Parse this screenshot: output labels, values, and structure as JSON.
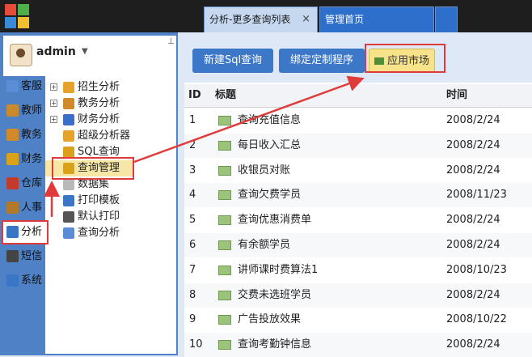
{
  "tabs": [
    {
      "label": "分析-更多查询列表",
      "close": "×"
    },
    {
      "label": "管理首页"
    }
  ],
  "user": {
    "name": "admin",
    "caret": "▼",
    "pin": "ᵖ"
  },
  "nav": [
    {
      "label": "客服",
      "icon": "headset-icon",
      "color": "#5b8dd6"
    },
    {
      "label": "教师",
      "icon": "teacher-book-icon",
      "color": "#c98a2b"
    },
    {
      "label": "教务",
      "icon": "academic-icon",
      "color": "#d08a2a"
    },
    {
      "label": "财务",
      "icon": "finance-icon",
      "color": "#d9a21a"
    },
    {
      "label": "仓库",
      "icon": "warehouse-icon",
      "color": "#c23b2b"
    },
    {
      "label": "人事",
      "icon": "personnel-icon",
      "color": "#b07a2a"
    },
    {
      "label": "分析",
      "icon": "bar-chart-icon",
      "color": "#3a76c6",
      "active": true
    },
    {
      "label": "短信",
      "icon": "phone-icon",
      "color": "#444444"
    },
    {
      "label": "系统",
      "icon": "system-icon",
      "color": "#3a76c6"
    }
  ],
  "tree": [
    {
      "label": "招生分析",
      "expandable": true,
      "icon": "search-icon",
      "color": "#e6a32a"
    },
    {
      "label": "教务分析",
      "expandable": true,
      "icon": "academic-icon",
      "color": "#d08a2a"
    },
    {
      "label": "财务分析",
      "expandable": true,
      "icon": "finance-icon",
      "color": "#3a6fc7"
    },
    {
      "label": "超级分析器",
      "expandable": false,
      "icon": "magnifier-icon",
      "color": "#e6a32a"
    },
    {
      "label": "SQL查询",
      "expandable": false,
      "icon": "sql-icon",
      "color": "#d9a21a"
    },
    {
      "label": "查询管理",
      "expandable": false,
      "icon": "sql-icon",
      "color": "#d9a21a",
      "selected": true
    },
    {
      "label": "数据集",
      "expandable": false,
      "icon": "xml-icon",
      "color": "#b9b9b9"
    },
    {
      "label": "打印模板",
      "expandable": false,
      "icon": "print-icon",
      "color": "#3a76c6"
    },
    {
      "label": "默认打印",
      "expandable": false,
      "icon": "print-icon",
      "color": "#555555"
    },
    {
      "label": "查询分析",
      "expandable": false,
      "icon": "search-icon",
      "color": "#5b8dd6"
    }
  ],
  "toolbar": {
    "new_sql": "新建Sql查询",
    "bind": "绑定定制程序",
    "market": "应用市场"
  },
  "table": {
    "headers": {
      "id": "ID",
      "title": "标题",
      "time": "时间"
    },
    "rows": [
      {
        "id": "1",
        "title": "查询充值信息",
        "time": "2008/2/24"
      },
      {
        "id": "2",
        "title": "每日收入汇总",
        "time": "2008/2/24"
      },
      {
        "id": "3",
        "title": "收银员对账",
        "time": "2008/2/24"
      },
      {
        "id": "4",
        "title": "查询欠费学员",
        "time": "2008/11/23"
      },
      {
        "id": "5",
        "title": "查询优惠消费单",
        "time": "2008/2/24"
      },
      {
        "id": "6",
        "title": "有余额学员",
        "time": "2008/2/24"
      },
      {
        "id": "7",
        "title": "讲师课时费算法1",
        "time": "2008/10/23"
      },
      {
        "id": "8",
        "title": "交费未选班学员",
        "time": "2008/2/24"
      },
      {
        "id": "9",
        "title": "广告投放效果",
        "time": "2008/10/22"
      },
      {
        "id": "10",
        "title": "查询考勤钟信息",
        "time": "2008/2/24"
      }
    ]
  },
  "colors": {
    "annotation": "#e03b3b",
    "accent": "#3d78c8",
    "topbar": "#1e1e1e"
  }
}
